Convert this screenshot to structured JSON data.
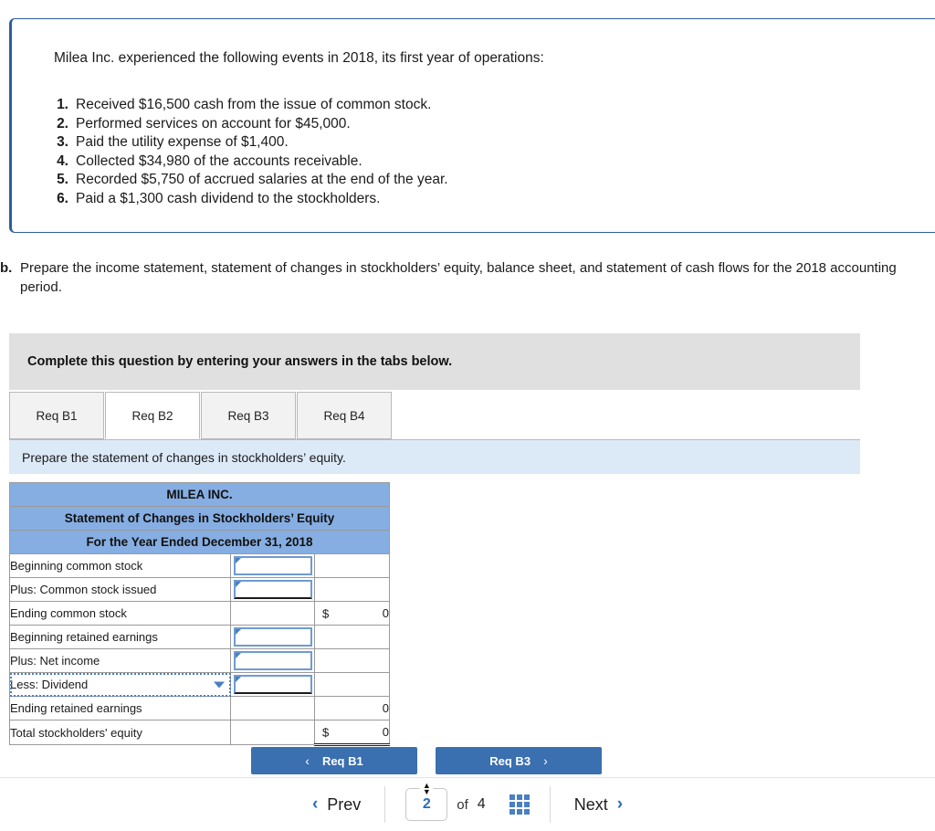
{
  "question": {
    "intro": "Milea Inc. experienced the following events in 2018, its first year of operations:",
    "events": [
      {
        "num": "1.",
        "text": "Received $16,500 cash from the issue of common stock."
      },
      {
        "num": "2.",
        "text": "Performed services on account for $45,000."
      },
      {
        "num": "3.",
        "text": "Paid the utility expense of $1,400."
      },
      {
        "num": "4.",
        "text": "Collected $34,980 of the accounts receivable."
      },
      {
        "num": "5.",
        "text": "Recorded $5,750 of accrued salaries at the end of the year."
      },
      {
        "num": "6.",
        "text": "Paid a $1,300 cash dividend to the stockholders."
      }
    ]
  },
  "requirement": {
    "label": "b.",
    "text": "Prepare the income statement, statement of changes in stockholders’ equity, balance sheet, and statement of cash flows for the 2018 accounting period."
  },
  "banner": {
    "text": "Complete this question by entering your answers in the tabs below."
  },
  "tabs": [
    {
      "label": "Req B1",
      "active": false
    },
    {
      "label": "Req B2",
      "active": true
    },
    {
      "label": "Req B3",
      "active": false
    },
    {
      "label": "Req B4",
      "active": false
    }
  ],
  "sub_instruction": {
    "text": "Prepare the statement of changes in stockholders’ equity."
  },
  "statement": {
    "headers": [
      "MILEA INC.",
      "Statement of Changes in Stockholders’ Equity",
      "For the Year Ended December 31, 2018"
    ],
    "rows": [
      {
        "label": "Beginning common stock",
        "kind": "input",
        "currency": "",
        "total": ""
      },
      {
        "label": "Plus: Common stock issued",
        "kind": "input",
        "currency": "",
        "total": ""
      },
      {
        "label": "Ending common stock",
        "kind": "total",
        "currency": "$",
        "total": "0"
      },
      {
        "label": "Beginning retained earnings",
        "kind": "input",
        "currency": "",
        "total": ""
      },
      {
        "label": "Plus: Net income",
        "kind": "input",
        "currency": "",
        "total": ""
      },
      {
        "label": "Less: Dividend",
        "kind": "select",
        "currency": "",
        "total": ""
      },
      {
        "label": "Ending retained earnings",
        "kind": "total",
        "currency": "",
        "total": "0"
      },
      {
        "label": "Total stockholders' equity",
        "kind": "total",
        "currency": "$",
        "total": "0"
      }
    ]
  },
  "req_nav": {
    "prev_label": "Req B1",
    "prev_chevron": "‹",
    "next_label": "Req B3",
    "next_chevron": "›"
  },
  "pager": {
    "prev_label": "Prev",
    "prev_arrow": "‹",
    "next_label": "Next",
    "next_arrow": "›",
    "current_page": "2",
    "of_label": "of",
    "total_pages": "4",
    "spinner_up": "▲",
    "spinner_down": "▼"
  },
  "colors": {
    "header_blue": "#86aee2",
    "sub_instruction_blue": "#dce9f7",
    "banner_grey": "#e0e0e0",
    "accent_blue": "#2b6cb8",
    "button_blue": "#3a6fb0"
  }
}
